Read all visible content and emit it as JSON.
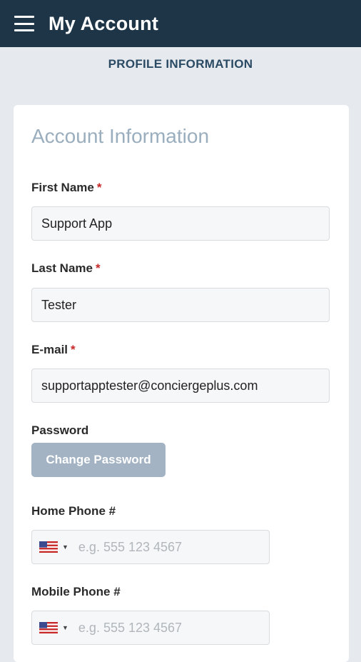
{
  "header": {
    "title": "My Account",
    "menu_icon": "hamburger-menu-icon"
  },
  "section_tab": "PROFILE INFORMATION",
  "card": {
    "title": "Account Information",
    "required_marker": "*",
    "first_name": {
      "label": "First Name",
      "value": "Support App"
    },
    "last_name": {
      "label": "Last Name",
      "value": "Tester"
    },
    "email": {
      "label": "E-mail",
      "value": "supportapptester@conciergeplus.com"
    },
    "password": {
      "label": "Password",
      "button_label": "Change Password"
    },
    "home_phone": {
      "label": "Home Phone #",
      "placeholder": "e.g. 555 123 4567",
      "country_icon": "us-flag-icon"
    },
    "mobile_phone": {
      "label": "Mobile Phone #",
      "placeholder": "e.g. 555 123 4567",
      "country_icon": "us-flag-icon"
    }
  },
  "colors": {
    "appbar": "#1e3547",
    "accent": "#2b4a63",
    "button": "#a3b3c3",
    "required": "#c62828"
  }
}
